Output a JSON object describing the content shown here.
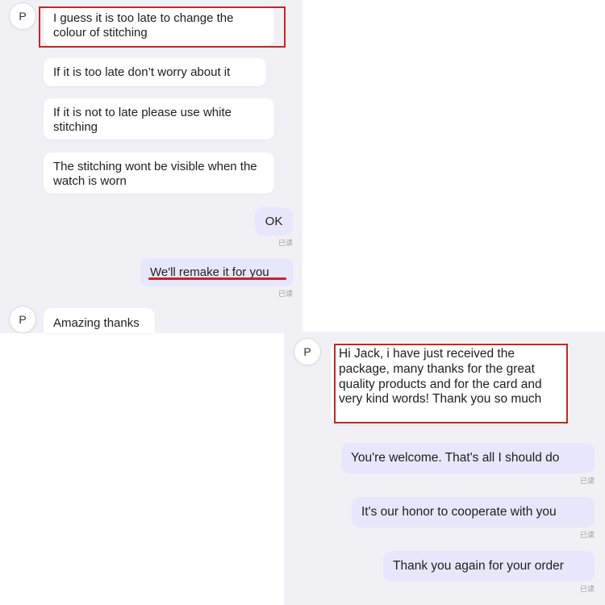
{
  "contact_initial": "P",
  "read_label": "已读",
  "highlight_color": "#d22020",
  "top_thread": {
    "messages": [
      {
        "from": "contact",
        "text": "I guess it is too late to change the colour of stitching",
        "highlighted": true
      },
      {
        "from": "contact",
        "text": "If it is too late don’t worry about it"
      },
      {
        "from": "contact",
        "text": "If it is not to late please use white stitching"
      },
      {
        "from": "contact",
        "text": "The stitching wont be visible when the watch is worn"
      },
      {
        "from": "me",
        "text": "OK",
        "status": "已读"
      },
      {
        "from": "me",
        "text": "We'll remake it for you",
        "status": "已读",
        "underlined": true
      },
      {
        "from": "contact",
        "text": "Amazing thanks"
      }
    ]
  },
  "bottom_thread": {
    "messages": [
      {
        "from": "contact",
        "text": "Hi Jack, i have just received the package, many thanks for the great quality products and for the card and very kind words! Thank you so much",
        "highlighted": true
      },
      {
        "from": "me",
        "text": "You're welcome. That's all I should do",
        "status": "已读"
      },
      {
        "from": "me",
        "text": "It's our honor to cooperate with you",
        "status": "已读"
      },
      {
        "from": "me",
        "text": "Thank you again for your order",
        "status": "已读"
      }
    ]
  }
}
